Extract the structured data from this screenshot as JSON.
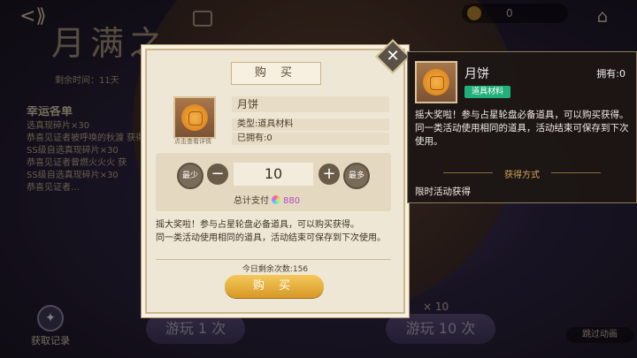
{
  "background": {
    "title": "月满之…",
    "remain_time": "剩余时间：11天",
    "coin_value": "0",
    "feed_title": "幸运各单",
    "feed_lines": [
      "选真现碎片×30",
      "恭喜见证者被呼唤的秋渡 获得",
      "SS级自选真现碎片×30",
      "恭喜见证者曾燃火火火 获",
      "SS级自选真现碎片×30",
      "恭喜见证者…"
    ],
    "record_label": "获取记录",
    "play1_label": "游玩 1 次",
    "play10_label": "游玩 10 次",
    "x10_label": "× 10",
    "skip_label": "跳过动画"
  },
  "dialog": {
    "title": "购 买",
    "close_glyph": "✕",
    "item_name": "月饼",
    "item_type": "类型:道具材料",
    "item_owned": "已拥有:0",
    "item_hint": "点击查看详情",
    "min_label": "最少",
    "max_label": "最多",
    "minus_glyph": "−",
    "plus_glyph": "+",
    "quantity": "10",
    "total_label": "总计支付",
    "total_value": "880",
    "description_1": "摇大奖啦！参与占星轮盘必备道具，可以购买获得。",
    "description_2": "同一类活动使用相同的道具，活动结束可保存到下次使用。",
    "today_remaining": "今日剩余次数:156",
    "buy_label": "购 买"
  },
  "tooltip": {
    "name": "月饼",
    "owned": "拥有:0",
    "tag": "道具材料",
    "description": "摇大奖啦！参与占星轮盘必备道具，可以购买获得。同一类活动使用相同的道具，活动结束可保存到下次使用。",
    "how_to_get": "获得方式",
    "source": "限时活动获得"
  },
  "colors": {
    "accent_gold": "#d79826",
    "tag_green": "#22b07a",
    "gem_value": "#b24abf"
  }
}
